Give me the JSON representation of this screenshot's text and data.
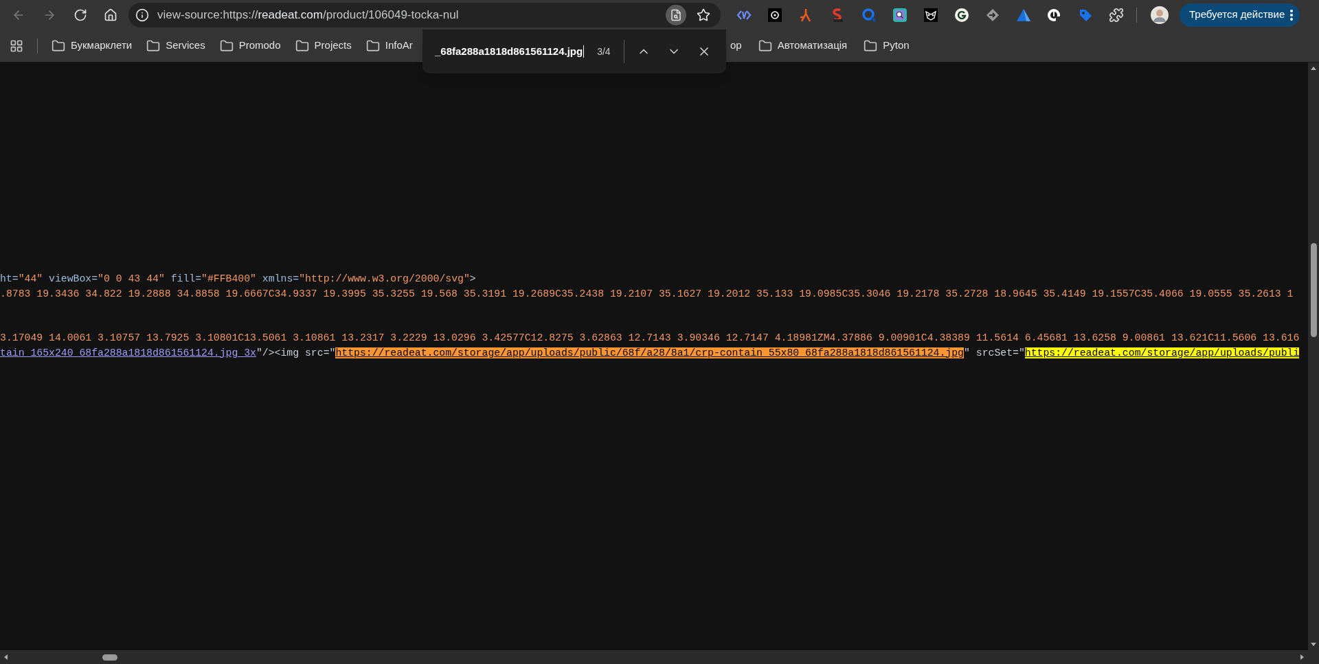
{
  "toolbar": {
    "back": {
      "disabled": true
    },
    "forward": {
      "disabled": true
    },
    "url": {
      "prefix": "view-source:https://",
      "host": "readeat.com",
      "path": "/product/106049-tocka-nul"
    },
    "action_button": "Требуется действие"
  },
  "bookmarks": [
    {
      "label": "Букмарклети",
      "kind": "folder"
    },
    {
      "label": "Services",
      "kind": "folder"
    },
    {
      "label": "Promodo",
      "kind": "folder"
    },
    {
      "label": "Projects",
      "kind": "folder"
    },
    {
      "label": "InfoAr",
      "kind": "folder"
    },
    {
      "label": "op",
      "kind": "partial"
    },
    {
      "label": "Автоматизація",
      "kind": "folder"
    },
    {
      "label": "Pyton",
      "kind": "folder"
    }
  ],
  "find_bar": {
    "value": "_68fa288a1818d861561124.jpg",
    "count": "3/4"
  },
  "source": {
    "blocks": [
      [
        [
          {
            "text": "ht=",
            "kind": "attr-name"
          },
          {
            "text": "\"44\"",
            "kind": "attr-value"
          },
          {
            "text": " viewBox=",
            "kind": "attr-name"
          },
          {
            "text": "\"0 0 43 44\"",
            "kind": "attr-value"
          },
          {
            "text": " fill=",
            "kind": "attr-name"
          },
          {
            "text": "\"#FFB400\"",
            "kind": "attr-value"
          },
          {
            "text": " xmlns=",
            "kind": "attr-name"
          },
          {
            "text": "\"http://www.w3.org/2000/svg\"",
            "kind": "attr-value"
          },
          {
            "text": ">",
            "kind": "tag"
          }
        ],
        [
          {
            "text": ".8783 19.3436 34.822 19.2888 34.8858 19.6667C34.9337 19.3995 35.3255 19.568 35.3191 19.2689C35.2438 19.2107 35.1627 19.2012 35.133 19.0985C35.3046 19.2178 35.2728 18.9645 35.4149 19.1557C35.4066 19.0555 35.2613 1",
            "kind": "attr-value"
          }
        ]
      ],
      [
        [
          {
            "text": "3.17049 14.0061 3.10757 13.7925 3.10801C13.5061 3.10861 13.2317 3.2229 13.0296 3.42577C12.8275 3.62863 12.7143 3.90346 12.7147 4.18981ZM4.37886 9.00901C4.38389 11.5614 6.45681 13.6258 9.00861 13.621C11.5606 13.616",
            "kind": "attr-value"
          }
        ],
        [
          {
            "text": "tain_165x240_68fa288a1818d861561124.jpg 3x",
            "kind": "link"
          },
          {
            "text": "\"/><img src=\"",
            "kind": "tag"
          },
          {
            "text": "https://readeat.com/storage/app/uploads/public/68f/a28/8a1/crp-contain_55x80_68fa288a1818d861561124.jpg",
            "kind": "match",
            "selected": true
          },
          {
            "text": "\" srcSet=\"",
            "kind": "tag"
          },
          {
            "text": "https://readeat.com/storage/app/uploads/publi",
            "kind": "match",
            "selected": false
          }
        ]
      ]
    ]
  }
}
